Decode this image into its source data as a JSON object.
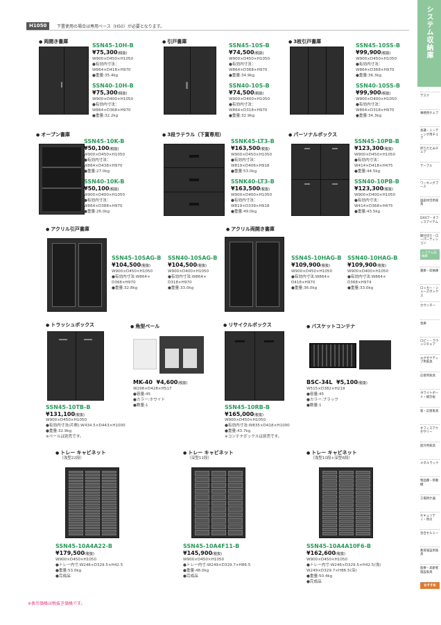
{
  "header": {
    "tag": "H1050",
    "note": "下置使用の場合は専用ベース（H50）が必要となります。"
  },
  "sidebar": {
    "title": "システム収納庫",
    "items": [
      "デスク",
      "事務用チェア",
      "会議・ミーティング用チェア",
      "折りたたみチェア",
      "テーブル",
      "ワーキングブース",
      "国産材活用家具",
      "DXICT・オフィスアイテム",
      "間仕切り・ローパーティション",
      "システム収納庫",
      "書庫・収納庫",
      "ロッカー・シューズボックス",
      "カウンター",
      "金庫",
      "ロビー・ラウンジチェア",
      "エグゼクティブ用家具",
      "応接用家具",
      "ホワイトボード・掲示板",
      "家・応接家具",
      "オフィスアクセサリー",
      "屋外用家具",
      "メタルラック",
      "物品棚・移動棚",
      "工場用什器",
      "セキュリティ・防災",
      "音合セルミー",
      "教育施設用家具",
      "医療・高齢者施設家具"
    ],
    "osusume": "おすすめ"
  },
  "sections": {
    "s1": "両開き書庫",
    "s2": "引戸書庫",
    "s3": "3枚引戸書庫",
    "s4": "オープン書庫",
    "s5": "3段ラテラル（下置専用）",
    "s6": "パーソナルボックス",
    "s7": "アクリル引戸書庫",
    "s8": "アクリル両開き書庫",
    "s9": "トラッシュボックス",
    "s10": "角型ペール",
    "s11": "リサイクルボックス",
    "s12": "バスケットコンテナ",
    "s13": "トレー キャビネット",
    "s13b": "（浅型22段）",
    "s14": "トレー キャビネット",
    "s14b": "（深型11段）",
    "s15": "トレー キャビネット",
    "s15b": "（浅型10段+深型6段）"
  },
  "p1": {
    "m1": "SSN45-10H-B",
    "pr1": "¥75,300",
    "d1": "W900×D450×H1050",
    "d2": "●有効内寸法：",
    "d3": "W864×D418×H970",
    "d4": "●重量:35.4kg",
    "m2": "SSN40-10H-B",
    "pr2": "¥75,300",
    "e1": "W900×D400×H1050",
    "e2": "●有効内寸法：",
    "e3": "W864×D368×H970",
    "e4": "●重量:32.2kg"
  },
  "p2": {
    "m1": "SSN45-10S-B",
    "pr1": "¥74,500",
    "d1": "W900×D450×H1050",
    "d2": "●有効内寸法：",
    "d3": "W864×D368×H970",
    "d4": "●重量:34.9kg",
    "m2": "SSN40-10S-B",
    "pr2": "¥74,500",
    "e1": "W900×D400×H1050",
    "e2": "●有効内寸法：",
    "e3": "W864×D318×H970",
    "e4": "●重量:32.9kg"
  },
  "p3": {
    "m1": "SSN45-10SS-B",
    "pr1": "¥99,900",
    "d1": "W900×D450×H1050",
    "d2": "●有効内寸法：",
    "d3": "W864×D368×H970",
    "d4": "●重量:36.3kg",
    "m2": "SSN40-10SS-B",
    "pr2": "¥99,900",
    "e1": "W900×D400×H1050",
    "e2": "●有効内寸法：",
    "e3": "W864×D318×H970",
    "e4": "●重量:34.3kg"
  },
  "p4": {
    "m1": "SSN45-10K-B",
    "pr1": "¥50,100",
    "d1": "W900×D450×H1050",
    "d2": "●有効内寸法：",
    "d3": "W864×D438×H970",
    "d4": "●重量:27.0kg",
    "m2": "SSN40-10K-B",
    "pr2": "¥50,100",
    "e1": "W900×D400×H1050",
    "e2": "●有効内寸法：",
    "e3": "W864×D388×H970",
    "e4": "●重量:26.0kg"
  },
  "p5": {
    "m1": "SSNK45-LT3-B",
    "pr1": "¥163,500",
    "d1": "W900×D450×H1050",
    "d2": "●有効内寸法：",
    "d3": "W819×D406×H918",
    "d4": "●重量:53.0kg",
    "m2": "SSNK40-LT3-B",
    "pr2": "¥163,500",
    "e1": "W900×D400×H1050",
    "e2": "●有効内寸法：",
    "e3": "W819×D339×H918",
    "e4": "●重量:49.0kg"
  },
  "p6": {
    "m1": "SSN45-10PB-B",
    "pr1": "¥123,300",
    "d1": "W900×D450×H1050",
    "d2": "●有効内寸法：",
    "d3": "W414×D418×H475",
    "d4": "●重量:44.5kg",
    "m2": "SSN40-10PB-B",
    "pr2": "¥123,300",
    "e1": "W900×D400×H1050",
    "e2": "●有効内寸法：",
    "e3": "W414×D368×H475",
    "e4": "●重量:43.5kg"
  },
  "p7": {
    "m1": "SSN45-10SAG-B",
    "pr1": "¥104,500",
    "d1": "W900×D450×H1050",
    "d2": "●有効内寸法:W864×",
    "d3": "D368×H970",
    "d4": "●重量:32.8kg",
    "m2": "SSN40-10SAG-B",
    "pr2": "¥104,500",
    "e1": "W900×D400×H1050",
    "e2": "●有効内寸法:W864×",
    "e3": "D318×H970",
    "e4": "●重量:33.0kg"
  },
  "p8": {
    "m1": "SSN45-10HAG-B",
    "pr1": "¥109,900",
    "d1": "W900×D450×H1050",
    "d2": "●有効内寸法:W864×",
    "d3": "D418×H970",
    "d4": "●重量:36.0kg",
    "m2": "SSN40-10HAG-B",
    "pr2": "¥109,900",
    "e1": "W900×D400×H1050",
    "e2": "●有効内寸法:W864×",
    "e3": "D368×H974",
    "e4": "●重量:33.0kg"
  },
  "p9": {
    "m1": "SSN45-10TB-B",
    "pr1": "¥131,100",
    "d1": "W900×D450×H1050",
    "d2": "●有効内寸法(片側):W434.5×D443×H1000",
    "d3": "●重量:32.9kg",
    "d4": "※ペールは別売です。"
  },
  "p10": {
    "m1": "MK-40",
    "pr1": "¥4,600",
    "d1": "W298×D428×H517",
    "d2": "●容量:45",
    "d3": "●カラー:ホワイト",
    "d4": "●数量:1"
  },
  "p11": {
    "m1": "SSN45-10RB-B",
    "pr1": "¥165,000",
    "d1": "W900×D450×H1050",
    "d2": "●有効内寸法:W835×D418×H1000",
    "d3": "●重量:43.7kg",
    "d4": "※コンテナボックスは別売です。"
  },
  "p12": {
    "m1": "BSC-34L",
    "pr1": "¥5,100",
    "d1": "W515×D382×H219",
    "d2": "●容量:45",
    "d3": "●カラー:ブラック",
    "d4": "●数量:1"
  },
  "p13": {
    "m1": "SSN45-10A4A22-B",
    "pr1": "¥179,500",
    "d1": "W900×D450×H1050",
    "d2": "●トレー内寸:W246×D329.5×H42.5",
    "d3": "●重量:53.0kg",
    "d4": "●完成品"
  },
  "p14": {
    "m1": "SSN45-10A4F11-B",
    "pr1": "¥145,900",
    "d1": "W900×D450×H1050",
    "d2": "●トレー内寸:W249×D329.7×H86.5",
    "d3": "●重量:48.0kg",
    "d4": "●完成品"
  },
  "p15": {
    "m1": "SSN45-10A4A10F6-B",
    "pr1": "¥162,600",
    "d1": "W900×D450×H1050",
    "d2": "●トレー内寸:W246×D329.5×H42.5(浅)",
    "d3": "W249×D329.7×H86.5(深)",
    "d4": "●重量:50.4kg",
    "d5": "●完成品"
  },
  "tax": "(税抜)",
  "footnote": "※表示価格は税抜き価格です。",
  "page_number": "275"
}
